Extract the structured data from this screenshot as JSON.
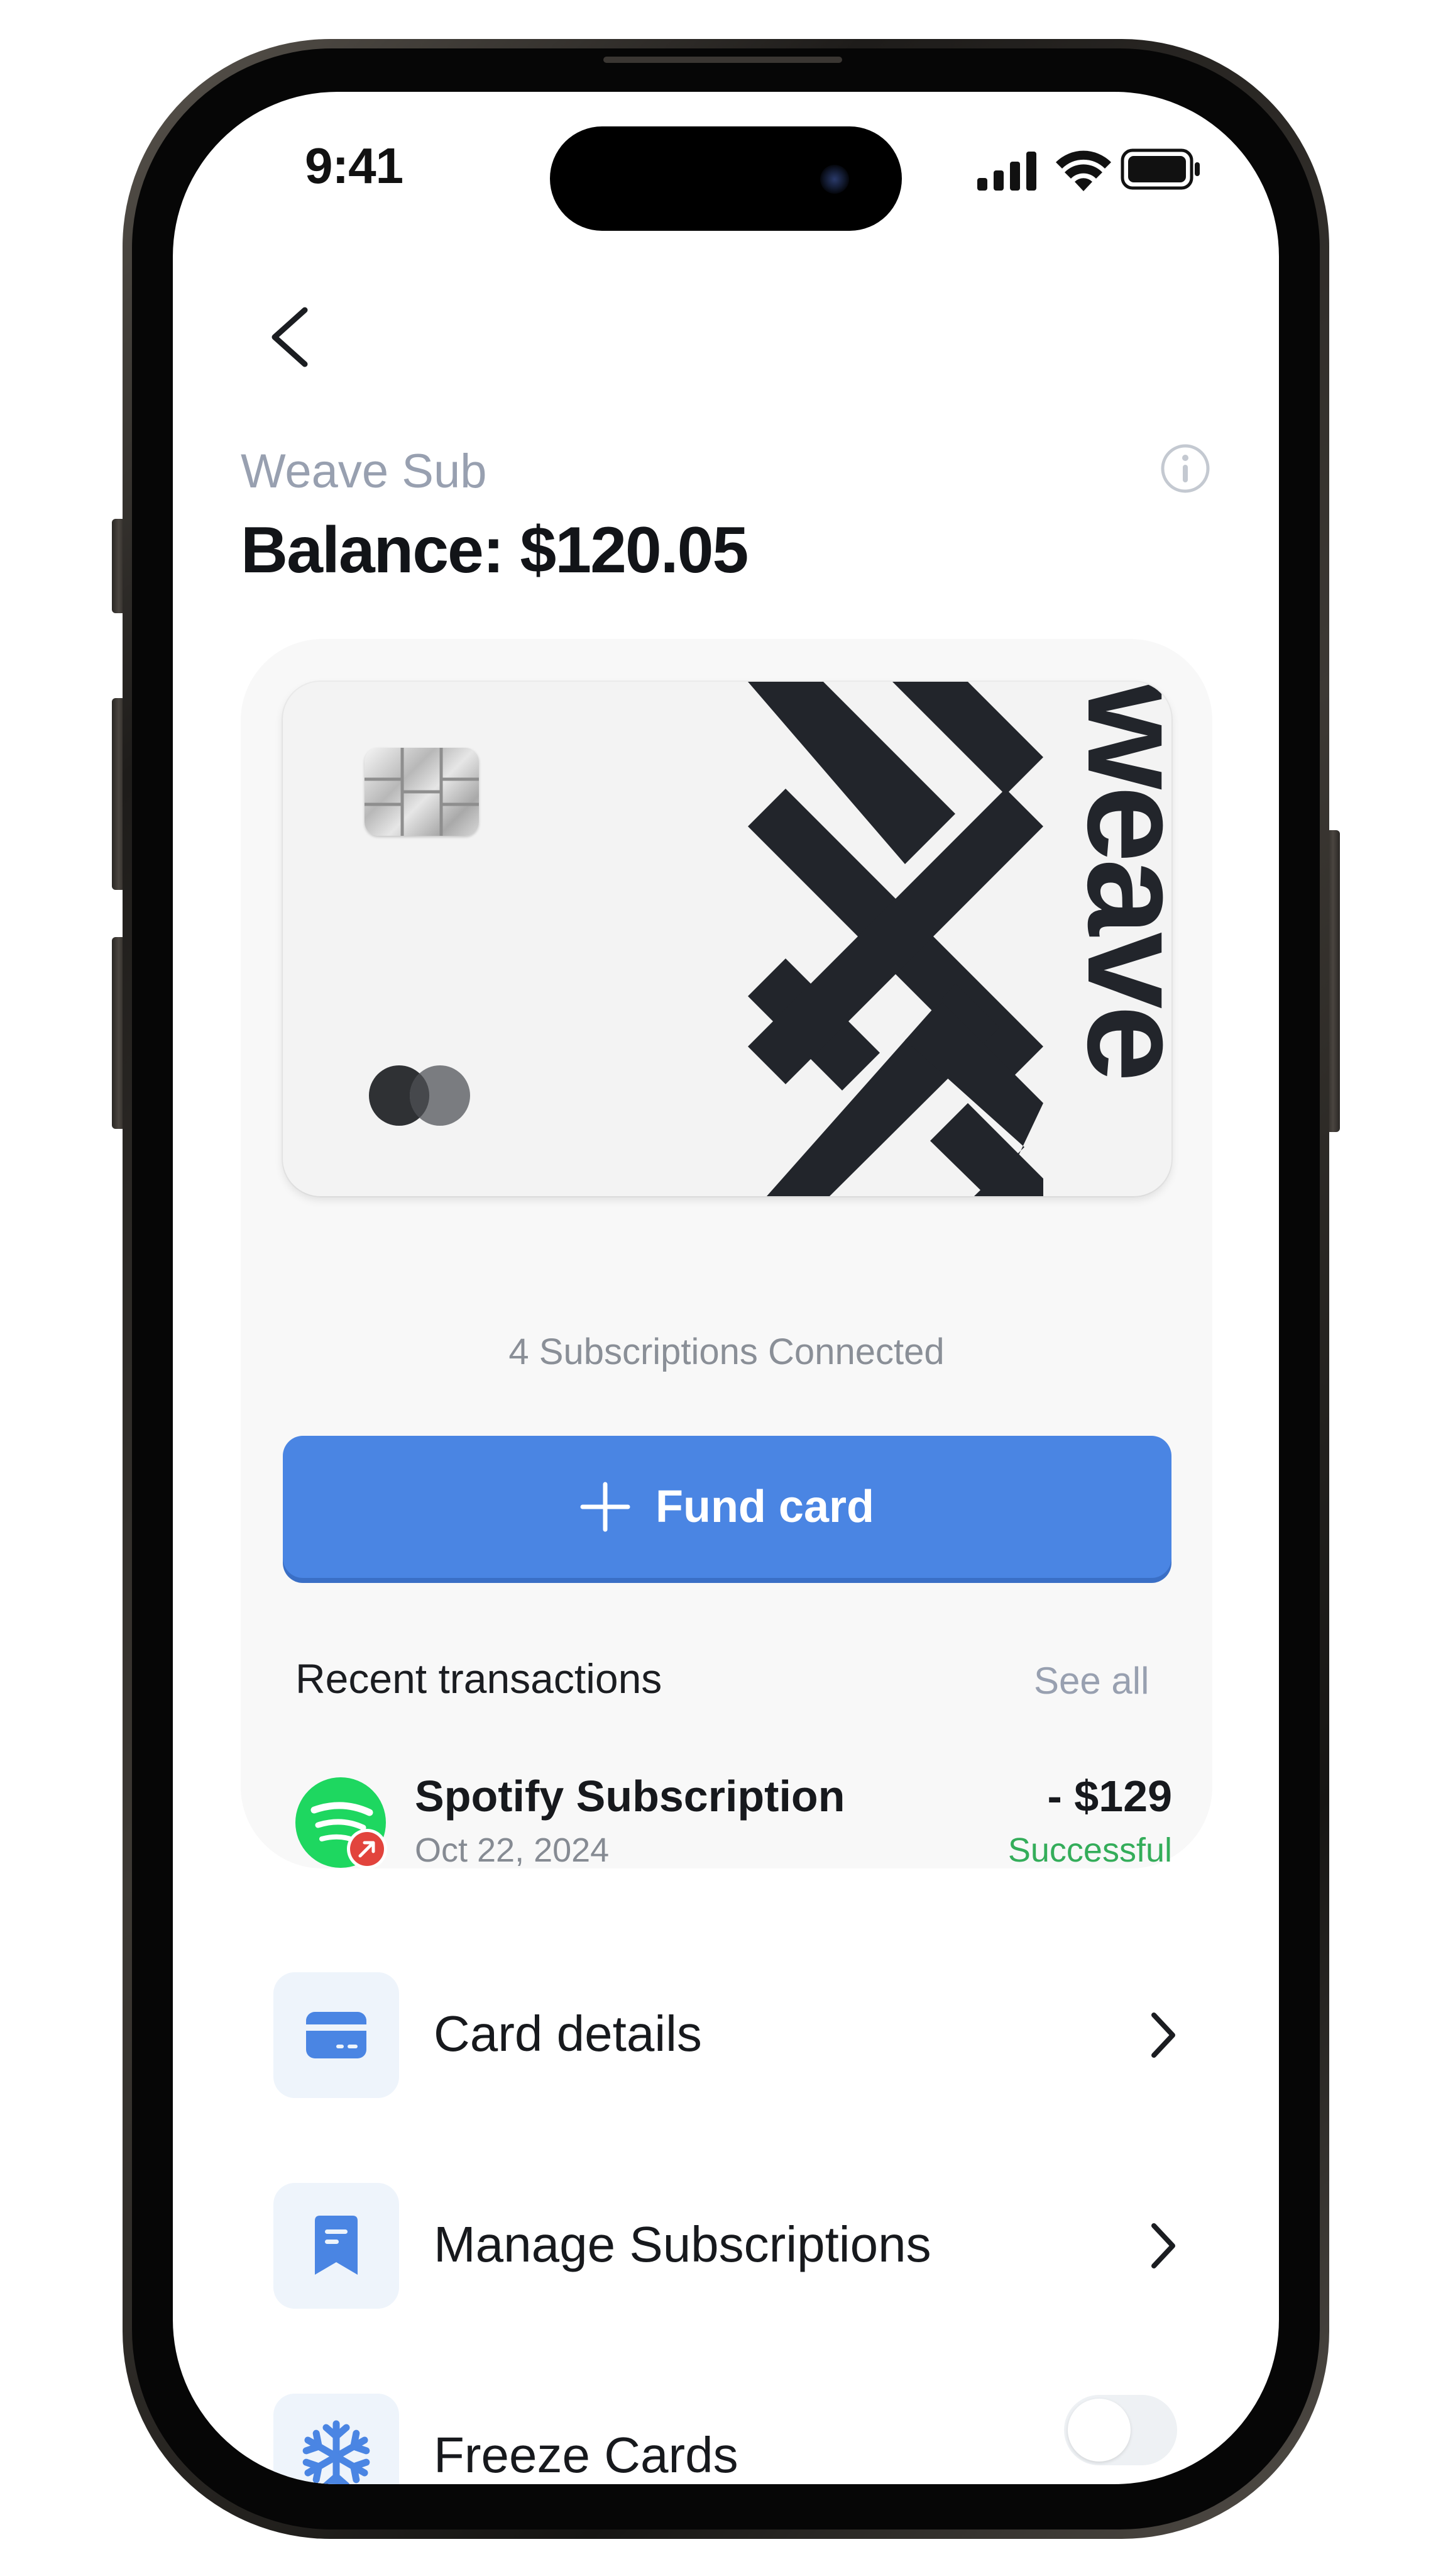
{
  "status_bar": {
    "time": "9:41"
  },
  "header": {
    "subtitle": "Weave Sub",
    "balance": "Balance: $120.05"
  },
  "card": {
    "brand_text": "weave",
    "subscriptions_connected": "4 Subscriptions Connected"
  },
  "fund_button": {
    "label": "Fund card"
  },
  "recent_transactions": {
    "title": "Recent transactions",
    "see_all": "See all",
    "items": [
      {
        "name": "Spotify Subscription",
        "date": "Oct 22, 2024",
        "amount": "- $129",
        "status": "Successful",
        "icon": "spotify-icon"
      }
    ]
  },
  "menu": [
    {
      "label": "Card details",
      "icon": "card-icon",
      "control": "chevron"
    },
    {
      "label": "Manage Subscriptions",
      "icon": "receipt-icon",
      "control": "chevron"
    },
    {
      "label": "Freeze Cards",
      "icon": "snowflake-icon",
      "control": "toggle",
      "toggle_on": false
    }
  ],
  "colors": {
    "accent": "#4a85e3",
    "success": "#34ad5a",
    "spotify": "#1ed760",
    "muted": "#98a0b0"
  }
}
